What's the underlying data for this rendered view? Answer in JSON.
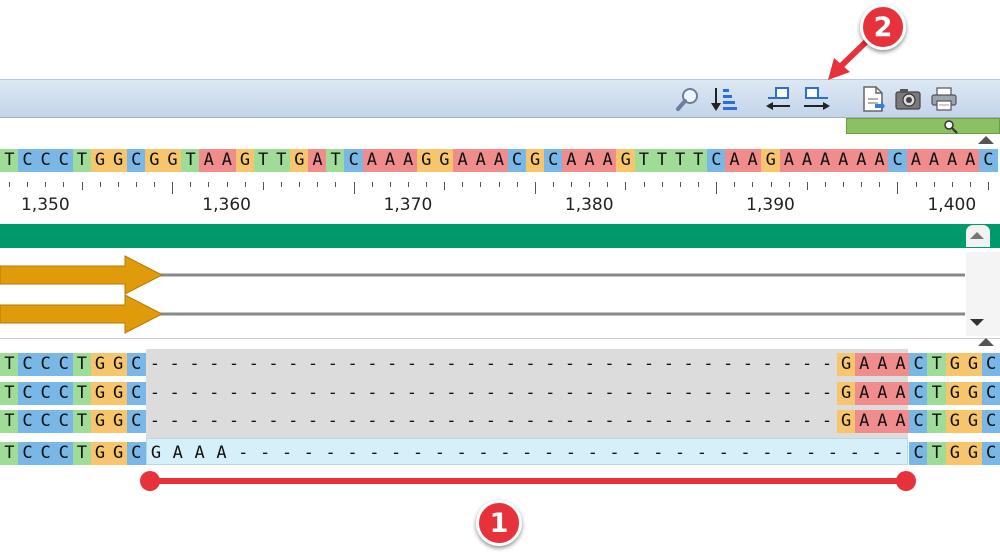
{
  "toolbar": {
    "icons": [
      "find-icon",
      "sort-icon",
      "collapse-left-icon",
      "expand-right-icon",
      "export-icon",
      "camera-icon",
      "print-icon"
    ]
  },
  "sequence": {
    "consensus": "TCCCTGGCGGTAAGTTGATCAAAGGAAACGCAAAGTTTTCAAGAAAAAACAAAAC",
    "ruler_labels": [
      "1,350",
      "1,360",
      "1,370",
      "1,380",
      "1,390",
      "1,400"
    ]
  },
  "alignment": {
    "rows": [
      "TCCCTGGC-----------------------------------GAAACTGGC",
      "TCCCTGGC-----------------------------------GAAACTGGC",
      "TCCCTGGC-----------------------------------GAAACTGGC",
      "TCCCTGGCGAAA-------------------------------CTGGC"
    ]
  },
  "colors": {
    "A": "#f08c8c",
    "C": "#78b7e6",
    "G": "#f7c56c",
    "T": "#9edc98"
  },
  "annotations": {
    "marker1": "1",
    "marker2": "2"
  }
}
